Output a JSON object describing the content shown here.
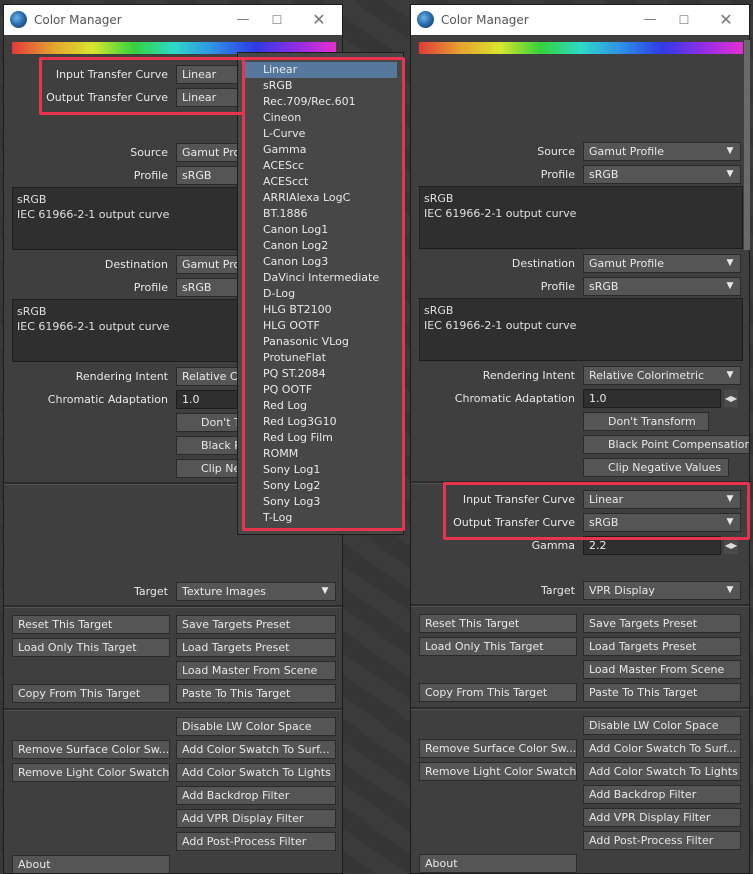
{
  "window_title": "Color Manager",
  "left": {
    "input_transfer_label": "Input Transfer Curve",
    "input_transfer_value": "Linear",
    "output_transfer_label": "Output Transfer Curve",
    "output_transfer_value": "Linear",
    "source_label": "Source",
    "source_value": "Gamut Profile",
    "profile_label": "Profile",
    "profile_value": "sRGB",
    "source_desc_line1": "sRGB",
    "source_desc_line2": "IEC 61966-2-1 output curve",
    "destination_label": "Destination",
    "destination_value": "Gamut Profile",
    "dest_profile_value": "sRGB",
    "dest_desc_line1": "sRGB",
    "dest_desc_line2": "IEC 61966-2-1 output curve",
    "rendering_label": "Rendering Intent",
    "rendering_value": "Relative Colorimetric",
    "chromatic_label": "Chromatic Adaptation",
    "chromatic_value": "1.0",
    "dont_transform": "Don't Transform",
    "black_point": "Black Point Compensation",
    "clip_negative": "Clip Negative Values",
    "target_label": "Target",
    "target_value": "Texture Images"
  },
  "right": {
    "source_label": "Source",
    "source_value": "Gamut Profile",
    "profile_label": "Profile",
    "profile_value": "sRGB",
    "source_desc_line1": "sRGB",
    "source_desc_line2": "IEC 61966-2-1 output curve",
    "destination_label": "Destination",
    "destination_value": "Gamut Profile",
    "dest_profile_value": "sRGB",
    "dest_desc_line1": "sRGB",
    "dest_desc_line2": "IEC 61966-2-1 output curve",
    "rendering_label": "Rendering Intent",
    "rendering_value": "Relative Colorimetric",
    "chromatic_label": "Chromatic Adaptation",
    "chromatic_value": "1.0",
    "dont_transform": "Don't Transform",
    "black_point": "Black Point Compensation",
    "clip_negative": "Clip Negative Values",
    "input_transfer_label": "Input Transfer Curve",
    "input_transfer_value": "Linear",
    "output_transfer_label": "Output Transfer Curve",
    "output_transfer_value": "sRGB",
    "gamma_label": "Gamma",
    "gamma_value": "2.2",
    "target_label": "Target",
    "target_value": "VPR Display"
  },
  "buttons": {
    "reset_target": "Reset This Target",
    "save_targets_preset": "Save Targets Preset",
    "load_only_target": "Load Only This Target",
    "load_targets_preset": "Load Targets Preset",
    "load_master": "Load Master From Scene",
    "copy_from_target": "Copy From This Target",
    "paste_to_target": "Paste To This Target",
    "disable_lw": "Disable LW Color Space",
    "remove_surface_swatch": "Remove Surface Color Sw...",
    "add_swatch_surf": "Add Color Swatch To Surf...",
    "remove_light_swatch": "Remove Light Color Swatch",
    "add_swatch_lights": "Add Color Swatch To Lights",
    "add_backdrop": "Add Backdrop Filter",
    "add_vpr": "Add VPR Display Filter",
    "add_post_process": "Add Post-Process Filter",
    "about": "About"
  },
  "dropdown_items": [
    "Linear",
    "sRGB",
    "Rec.709/Rec.601",
    "Cineon",
    "L-Curve",
    "Gamma",
    "ACEScc",
    "ACEScct",
    "ARRIAlexa LogC",
    "BT.1886",
    "Canon Log1",
    "Canon Log2",
    "Canon Log3",
    "DaVinci Intermediate",
    "D-Log",
    "HLG BT2100",
    "HLG OOTF",
    "Panasonic VLog",
    "ProtuneFlat",
    "PQ ST.2084",
    "PQ OOTF",
    "Red Log",
    "Red Log3G10",
    "Red Log Film",
    "ROMM",
    "Sony Log1",
    "Sony Log2",
    "Sony Log3",
    "T-Log"
  ],
  "dropdown_selected": "Linear",
  "colors": {
    "highlight": "#e8344f",
    "selected_item": "#56789c",
    "panel": "#3f3f3f"
  },
  "icons": {
    "app": "color-manager-logo-icon",
    "minimize": "minimize-icon",
    "maximize": "maximize-icon",
    "close": "close-icon",
    "chevron": "chevron-down-icon",
    "spin": "spin-arrows-icon"
  }
}
